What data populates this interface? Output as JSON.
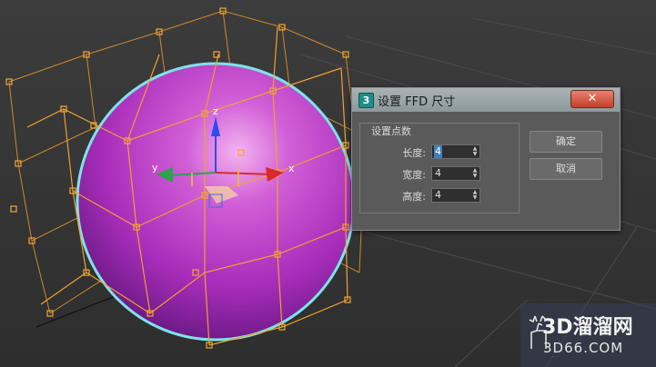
{
  "viewport": {
    "description_icons": [
      "axis-gizmo-icon"
    ],
    "axis_labels": {
      "x": "x",
      "y": "y",
      "z": "z"
    },
    "colors": {
      "background": "#3a3a3a",
      "sphere": "#b638c6",
      "lattice": "#f0a030",
      "selection_outline": "#7de3e8"
    }
  },
  "dialog": {
    "app_icon": "3",
    "title": "设置 FFD 尺寸",
    "close_symbol": "✕",
    "group_label": "设置点数",
    "fields": [
      {
        "label": "长度:",
        "value": "4"
      },
      {
        "label": "宽度:",
        "value": "4"
      },
      {
        "label": "高度:",
        "value": "4"
      }
    ],
    "ok_label": "确定",
    "cancel_label": "取消"
  },
  "watermark": {
    "line1": "3D溜溜网",
    "line2": "3D66.COM"
  }
}
